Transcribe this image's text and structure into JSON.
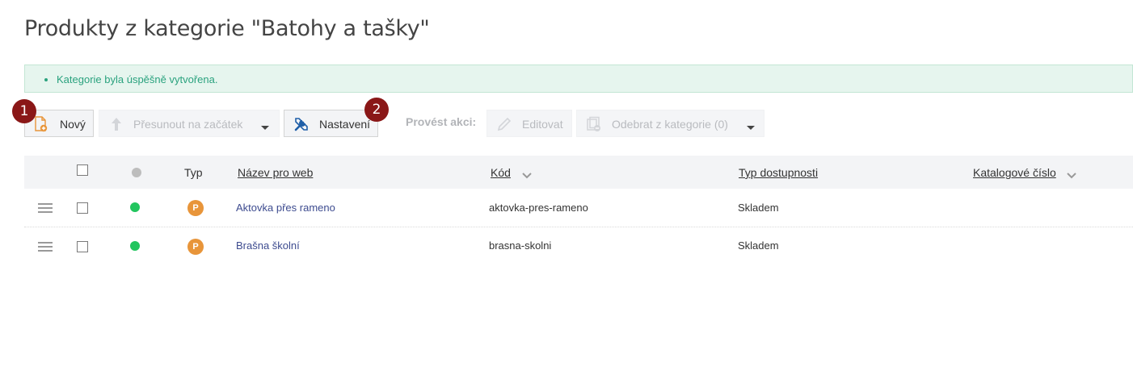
{
  "page": {
    "title": "Produkty z kategorie \"Batohy a tašky\""
  },
  "flash": {
    "message": "Kategorie byla úspěšně vytvořena."
  },
  "toolbar": {
    "new_label": "Nový",
    "move_label": "Přesunout na začátek",
    "settings_label": "Nastavení",
    "actions_label": "Provést akci:",
    "edit_label": "Editovat",
    "remove_label": "Odebrat z kategorie (0)"
  },
  "badges": {
    "one": "1",
    "two": "2"
  },
  "table": {
    "headers": {
      "type": "Typ",
      "name": "Název pro web",
      "code": "Kód",
      "availability": "Typ dostupnosti",
      "catalog": "Katalogové číslo"
    },
    "rows": [
      {
        "type": "P",
        "name": "Aktovka přes rameno",
        "code": "aktovka-pres-rameno",
        "availability": "Skladem"
      },
      {
        "type": "P",
        "name": "Brašna školní",
        "code": "brasna-skolni",
        "availability": "Skladem"
      }
    ]
  },
  "icons": {
    "new": "new-document-icon",
    "move": "arrow-up-icon",
    "settings": "tools-icon",
    "edit": "pencil-icon",
    "remove": "remove-from-category-icon",
    "drag": "drag-handle-icon",
    "sort": "chevron-down-icon"
  },
  "colors": {
    "accent": "#e8953a",
    "status_active": "#22c55e",
    "status_header": "#bdbdbd",
    "badge": "#8a1717",
    "flash_text": "#2aa27e",
    "link": "#3d4b8f",
    "settings_icon": "#1f5fa8"
  }
}
